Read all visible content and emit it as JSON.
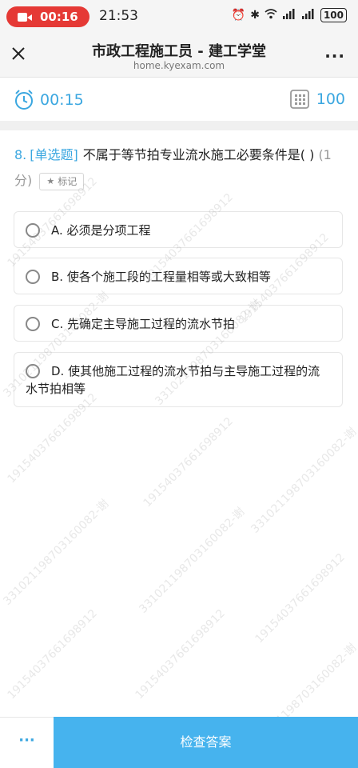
{
  "status_bar": {
    "record_time": "00:16",
    "clock": "21:53",
    "battery": "100"
  },
  "nav": {
    "title": "市政工程施工员 - 建工学堂",
    "subtitle": "home.kyexam.com"
  },
  "toolbar": {
    "timer": "00:15",
    "question_count": "100"
  },
  "question": {
    "number": "8.",
    "type": "[单选题]",
    "text": "不属于等节拍专业流水施工必要条件是( )",
    "score": "(1分)",
    "mark_label": "标记"
  },
  "options": [
    {
      "label": "A. 必须是分项工程"
    },
    {
      "label": "B. 使各个施工段的工程量相等或大致相等"
    },
    {
      "label": "C. 先确定主导施工过程的流水节拍"
    },
    {
      "label": "D. 使其他施工过程的流水节拍与主导施工过程的流水节拍相等"
    }
  ],
  "bottom": {
    "more": "···",
    "check_answer": "检查答案"
  },
  "watermark": {
    "line1": "19154037661698912",
    "line2": "331021198703160082-谢"
  },
  "colors": {
    "accent": "#3ba7e0",
    "button": "#46b3ee",
    "record": "#e53935"
  }
}
